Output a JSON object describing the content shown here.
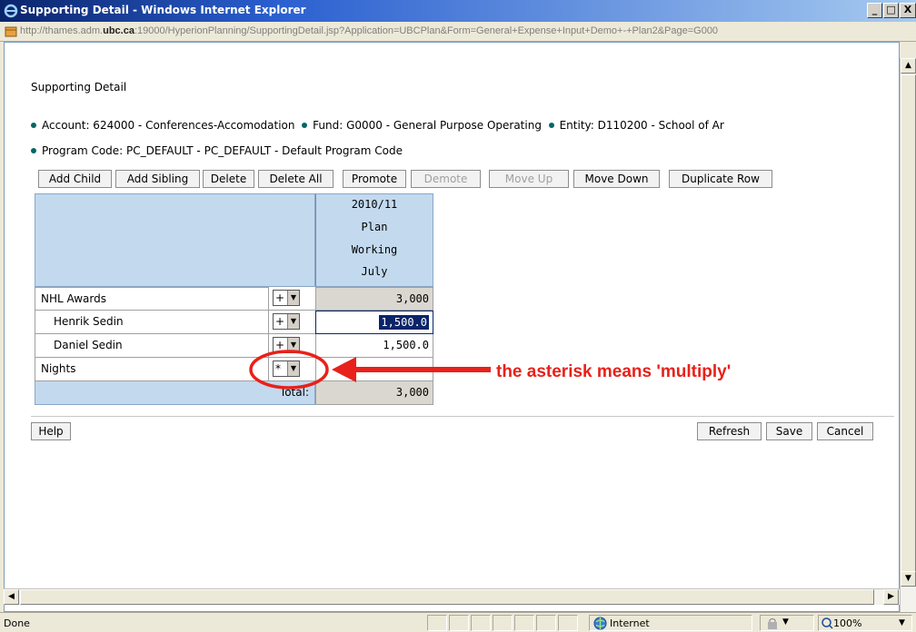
{
  "window": {
    "title": "Supporting Detail - Windows Internet Explorer",
    "url_prefix": "http://thames.adm.",
    "url_domain": "ubc.ca",
    "url_suffix": ":19000/HyperionPlanning/SupportingDetail.jsp?Application=UBCPlan&Form=General+Expense+Input+Demo+-+Plan2&Page=G000",
    "minimize_label": "_",
    "maximize_label": "□",
    "close_label": "X"
  },
  "page": {
    "title": "Supporting Detail",
    "account": "Account: 624000 - Conferences-Accomodation",
    "fund": "Fund: G0000 - General Purpose Operating",
    "entity": "Entity: D110200 - School of Ar",
    "program_code": "Program Code: PC_DEFAULT - PC_DEFAULT - Default Program Code"
  },
  "toolbar": {
    "add_child": "Add Child",
    "add_sibling": "Add Sibling",
    "delete": "Delete",
    "delete_all": "Delete All",
    "promote": "Promote",
    "demote": "Demote",
    "move_up": "Move Up",
    "move_down": "Move Down",
    "duplicate_row": "Duplicate Row"
  },
  "grid": {
    "header": {
      "year": "2010/11",
      "scenario": "Plan",
      "version": "Working",
      "period": "July"
    },
    "rows": [
      {
        "label": "NHL Awards",
        "operator": "+",
        "value": "3,000"
      },
      {
        "label": "Henrik Sedin",
        "operator": "+",
        "value": "1,500.0"
      },
      {
        "label": "Daniel Sedin",
        "operator": "+",
        "value": "1,500.0"
      },
      {
        "label": "Nights",
        "operator": "*",
        "value": ""
      }
    ],
    "total_label": "Total:",
    "total_value": "3,000"
  },
  "buttons": {
    "help": "Help",
    "refresh": "Refresh",
    "save": "Save",
    "cancel": "Cancel"
  },
  "annotation": {
    "text": "the asterisk means 'multiply'",
    "color": "#e8211a"
  },
  "statusbar": {
    "status": "Done",
    "zone": "Internet",
    "zoom": "100%"
  }
}
